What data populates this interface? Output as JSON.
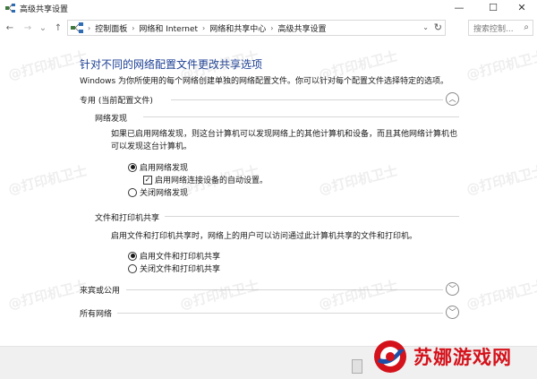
{
  "window": {
    "title": "高级共享设置",
    "minimize_glyph": "—",
    "maximize_glyph": "☐",
    "close_glyph": "✕"
  },
  "nav": {
    "back_glyph": "←",
    "forward_glyph": "→",
    "dropdown_glyph": "⌄",
    "up_glyph": "↑",
    "breadcrumb": [
      "控制面板",
      "网络和 Internet",
      "网络和共享中心",
      "高级共享设置"
    ],
    "crumb_separator": "›",
    "refresh_glyph": "↻",
    "search_placeholder": "搜索控制...",
    "search_glyph": "⌕"
  },
  "page": {
    "heading": "针对不同的网络配置文件更改共享选项",
    "description": "Windows 为你所使用的每个网络创建单独的网络配置文件。你可以针对每个配置文件选择特定的选项。"
  },
  "profiles": {
    "private": {
      "label": "专用 (当前配置文件)",
      "expanded": true,
      "chevron": "︿"
    },
    "guest": {
      "label": "来宾或公用",
      "expanded": false,
      "chevron": "﹀"
    },
    "all": {
      "label": "所有网络",
      "expanded": false,
      "chevron": "﹀"
    }
  },
  "network_discovery": {
    "title": "网络发现",
    "text_line1": "如果已启用网络发现，则这台计算机可以发现网络上的其他计算机和设备，而且其他网络计算机也",
    "text_line2": "可以发现这台计算机。",
    "option_on": "启用网络发现",
    "option_auto": "启用网络连接设备的自动设置。",
    "option_off": "关闭网络发现",
    "selected": "on",
    "auto_setup_checked": true,
    "check_glyph": "✓"
  },
  "file_sharing": {
    "title": "文件和打印机共享",
    "text": "启用文件和打印机共享时，网络上的用户可以访问通过此计算机共享的文件和打印机。",
    "option_on": "启用文件和打印机共享",
    "option_off": "关闭文件和打印机共享",
    "selected": "on"
  },
  "watermark_text": "@打印机卫士",
  "site_logo": {
    "text": "苏娜游戏网",
    "color": "#d4121b"
  },
  "colors": {
    "heading": "#1c3f94",
    "footer": "#f0f0f0"
  }
}
